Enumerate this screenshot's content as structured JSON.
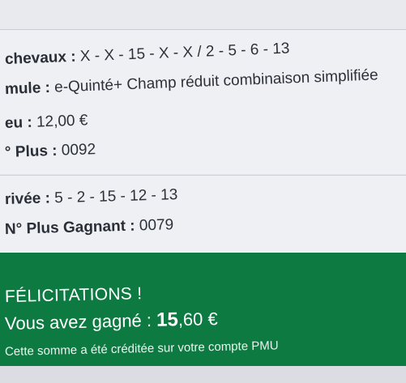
{
  "bet": {
    "horses_label": "chevaux :",
    "horses_value": "X - X - 15 - X - X / 2 - 5 - 6 - 13",
    "formula_label": "mule :",
    "formula_value": "e-Quinté+ Champ réduit combinaison simplifiée",
    "stake_label": "eu :",
    "stake_value": "12,00 €",
    "plus_label": "° Plus :",
    "plus_value": "0092"
  },
  "result": {
    "arrival_label": "rivée :",
    "arrival_value": "5 - 2 - 15 - 12 - 13",
    "winning_plus_label": "N° Plus Gagnant :",
    "winning_plus_value": "0079"
  },
  "win": {
    "title": "FÉLICITATIONS !",
    "amount_prefix": "Vous avez gagné : ",
    "amount_int": "15",
    "amount_dec": ",60 €",
    "note": "Cette somme a été créditée sur votre compte PMU"
  },
  "colors": {
    "success_green": "#0d7a42",
    "card_bg": "#eef0f3"
  }
}
